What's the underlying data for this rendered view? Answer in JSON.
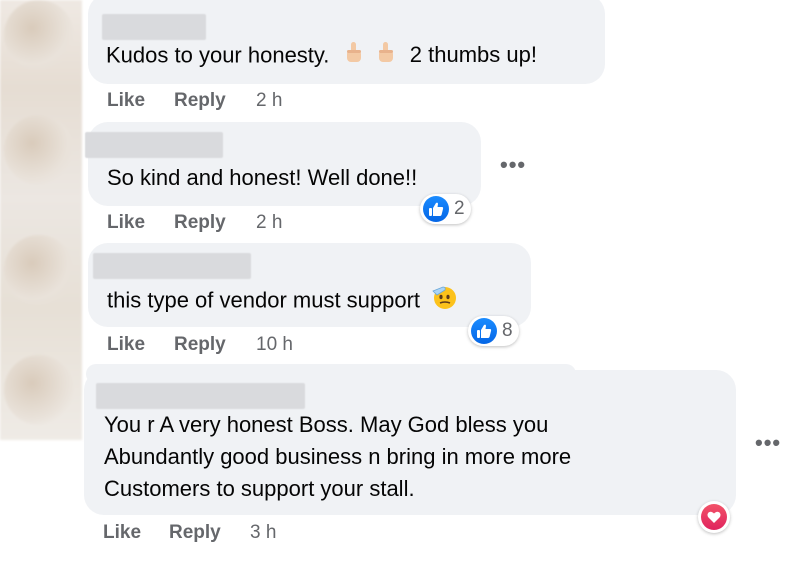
{
  "comments": [
    {
      "text": "Kudos to your honesty.",
      "text_after": "2 thumbs up!",
      "emoji_before": [
        "thumbs-up-icon",
        "thumbs-up-icon"
      ],
      "like": "Like",
      "reply": "Reply",
      "time": "2 h"
    },
    {
      "text": "So kind and honest! Well done!!",
      "reaction_count": "2",
      "like": "Like",
      "reply": "Reply",
      "time": "2 h"
    },
    {
      "text": "this type of vendor must support",
      "emoji_after": "saluting-face-icon",
      "reaction_count": "8",
      "like": "Like",
      "reply": "Reply",
      "time": "10 h"
    },
    {
      "lines": [
        "You r A very honest Boss. May God bless you",
        "Abundantly good business n bring in more more",
        "Customers to support your stall."
      ],
      "reaction": "heart-icon",
      "like": "Like",
      "reply": "Reply",
      "time": "3 h"
    }
  ],
  "more_options": "•••",
  "colors": {
    "bubble": "#f0f2f5",
    "meta_text": "#65676b",
    "like_blue": "#1877f2",
    "love_red": "#f33e58"
  }
}
